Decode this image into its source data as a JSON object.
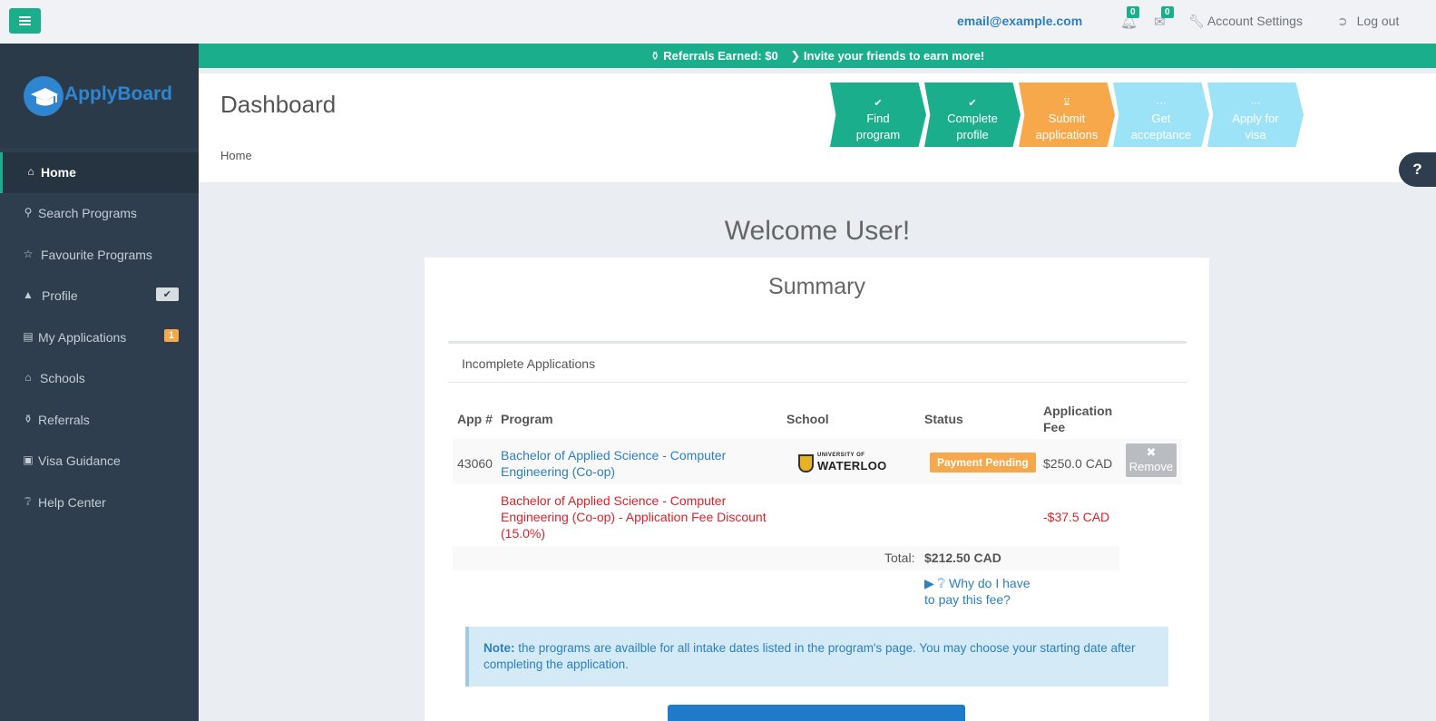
{
  "topbar": {
    "email": "email@example.com",
    "notifications_count": "0",
    "messages_count": "0",
    "account_settings": "Account Settings",
    "logout": "Log out"
  },
  "brand": {
    "name": "ApplyBoard",
    "color": "#2e86d1"
  },
  "sidebar": {
    "items": [
      {
        "label": "Home",
        "icon": "home-icon",
        "active": true
      },
      {
        "label": "Search Programs",
        "icon": "search-icon"
      },
      {
        "label": "Favourite Programs",
        "icon": "star-icon"
      },
      {
        "label": "Profile",
        "icon": "graduation-cap-icon",
        "badge": "✔"
      },
      {
        "label": "My Applications",
        "icon": "list-icon",
        "badge": "1"
      },
      {
        "label": "Schools",
        "icon": "institution-icon"
      },
      {
        "label": "Referrals",
        "icon": "trophy-icon"
      },
      {
        "label": "Visa Guidance",
        "icon": "briefcase-icon"
      },
      {
        "label": "Help Center",
        "icon": "question-circle-icon"
      }
    ]
  },
  "referral_bar": {
    "earned": "Referrals Earned: $0",
    "invite": "Invite your friends to earn more!"
  },
  "header": {
    "title": "Dashboard",
    "breadcrumb": "Home"
  },
  "steps": [
    {
      "line1": "Find",
      "line2": "program",
      "state": "done",
      "color": "#1aae8c"
    },
    {
      "line1": "Complete",
      "line2": "profile",
      "state": "done",
      "color": "#1aae8c"
    },
    {
      "line1": "Submit",
      "line2": "applications",
      "state": "current",
      "color": "#f7a84a"
    },
    {
      "line1": "Get",
      "line2": "acceptance",
      "state": "pending",
      "color": "#9ce3f7"
    },
    {
      "line1": "Apply for",
      "line2": "visa",
      "state": "pending",
      "color": "#9ce3f7"
    }
  ],
  "welcome": "Welcome User!",
  "summary": {
    "title": "Summary",
    "section": "Incomplete Applications",
    "columns": [
      "App #",
      "Program",
      "School",
      "Status",
      "Application",
      "Fee"
    ],
    "application": {
      "app_no": "43060",
      "program_line1": "Bachelor of Applied Science - Computer",
      "program_line2": "Engineering (Co-op)",
      "school_small": "UNIVERSITY OF",
      "school_big": "WATERLOO",
      "status": "Payment Pending",
      "fee": "$250.0 CAD",
      "remove": "Remove"
    },
    "discount": {
      "line1": "Bachelor of Applied Science - Computer",
      "line2": "Engineering (Co-op) - Application Fee Discount",
      "line3": "(15.0%)",
      "amount": "-$37.5 CAD"
    },
    "total_label": "Total:",
    "total_value": "$212.50 CAD",
    "why_line1": "Why do I have",
    "why_line2": "to pay this fee?",
    "note_label": "Note:",
    "note_text": "the programs are availble for all intake dates listed in the program's page. You may choose your starting date after completing the application."
  },
  "help_tab": "?"
}
